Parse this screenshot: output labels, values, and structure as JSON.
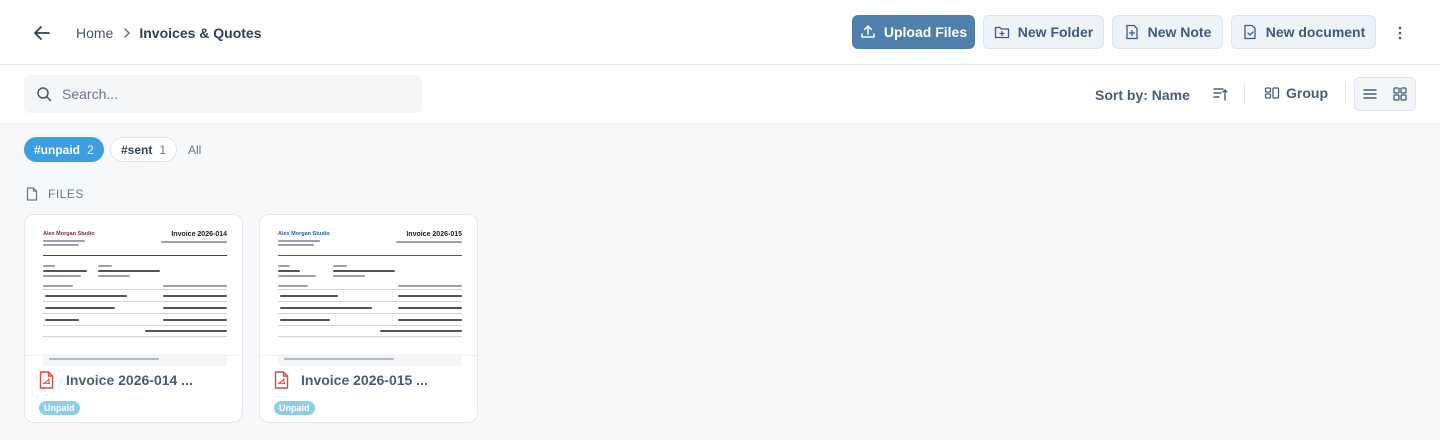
{
  "breadcrumb": {
    "home": "Home",
    "current": "Invoices & Quotes"
  },
  "header_actions": {
    "upload": "Upload Files",
    "new_folder": "New Folder",
    "new_note": "New Note",
    "new_document": "New document"
  },
  "toolbar": {
    "search_placeholder": "Search...",
    "sort_label": "Sort by: Name",
    "group_label": "Group",
    "view_mode": "grid"
  },
  "tags": [
    {
      "label": "#unpaid",
      "count": "2",
      "active": true
    },
    {
      "label": "#sent",
      "count": "1",
      "active": false
    },
    {
      "label": "All"
    }
  ],
  "section_title": "FILES",
  "files": [
    {
      "name": "Invoice 2026-014 ...",
      "badge": "Unpaid",
      "preview": {
        "brand": "Alex Morgan Studio",
        "brand_color": "#7a2e2e",
        "title": "Invoice 2026-014"
      }
    },
    {
      "name": "Invoice 2026-015 ...",
      "badge": "Unpaid",
      "preview": {
        "brand": "Alex Morgan Studio",
        "brand_color": "#2a5db0",
        "title": "Invoice 2026-015"
      }
    }
  ],
  "colors": {
    "primary": "#4f7fab",
    "tag_active": "#3d9ee0",
    "badge": "#8ccde9",
    "pdf_icon": "#e0474c"
  }
}
